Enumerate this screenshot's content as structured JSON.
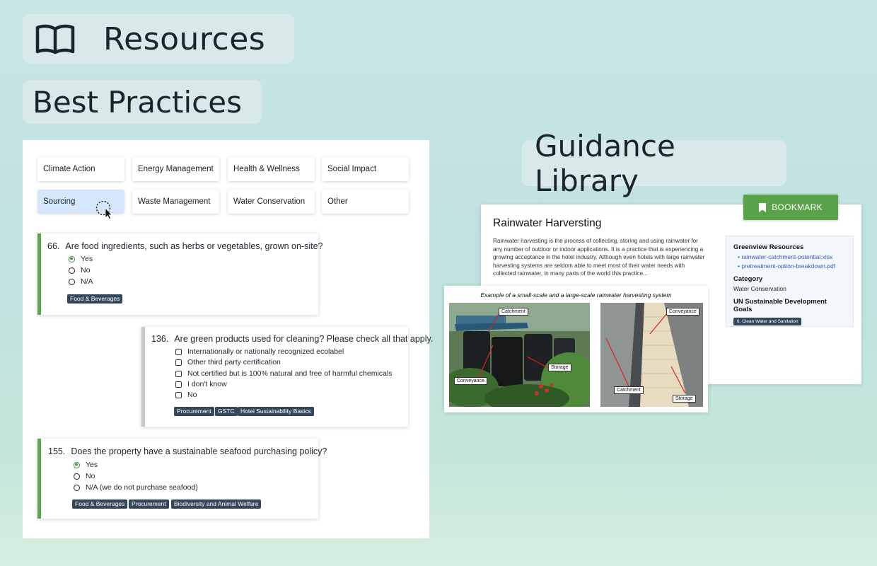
{
  "headers": {
    "resources": "Resources",
    "best_practices": "Best Practices",
    "guidance_library": "Guidance Library"
  },
  "categories": [
    {
      "label": "Climate Action",
      "active": false
    },
    {
      "label": "Energy Management",
      "active": false
    },
    {
      "label": "Health & Wellness",
      "active": false
    },
    {
      "label": "Social Impact",
      "active": false
    },
    {
      "label": "Sourcing",
      "active": true
    },
    {
      "label": "Waste Management",
      "active": false
    },
    {
      "label": "Water Conservation",
      "active": false
    },
    {
      "label": "Other",
      "active": false
    }
  ],
  "questions": [
    {
      "number": "66.",
      "text": "Are food ingredients, such as herbs or vegetables, grown on-site?",
      "options": [
        "Yes",
        "No",
        "N/A"
      ],
      "selected": "Yes",
      "tags": [
        "Food & Beverages"
      ]
    },
    {
      "number": "136.",
      "text": "Are green products used for cleaning? Please check all that apply.",
      "options": [
        "Internationally or nationally recognized ecolabel",
        "Other third party certification",
        "Not certified but is 100% natural and free of harmful chemicals",
        "I don't know",
        "No"
      ],
      "tags": [
        "Procurement",
        "GSTC",
        "Hotel Sustainability Basics"
      ]
    },
    {
      "number": "155.",
      "text": "Does the property have a sustainable seafood purchasing policy?",
      "options": [
        "Yes",
        "No",
        "N/A (we do not purchase seafood)"
      ],
      "selected": "Yes",
      "tags": [
        "Food & Beverages",
        "Procurement",
        "Biodiversity and Animal Welfare"
      ]
    }
  ],
  "guidance": {
    "bookmark_label": "BOOKMARK",
    "title": "Rainwater Harversting",
    "body": "Rainwater harvesting is the process of collecting, storing and using rainwater for any number of outdoor or indoor applications. It is a practice that is experiencing a growing acceptance in the hotel industry. Although even hotels with large rainwater harvesting systems are seldom able to meet most of their water needs with collected rainwater, in many parts of the world this practice...",
    "resources_heading": "Greenview Resources",
    "resources": [
      "rainwater-catchment-potential.xlsx",
      "pretreatment-option-breakdown.pdf"
    ],
    "category_heading": "Category",
    "category_value": "Water Conservation",
    "sdg_heading": "UN Sustainable Development Goals",
    "sdg_tag": "6. Clean Water and Sanitation",
    "figure_caption": "Example of a small-scale and a large-scale rainwater harvesting system",
    "photo_left_labels": [
      "Catchment",
      "Storage",
      "Conveyance"
    ],
    "photo_right_labels": [
      "Conveyance",
      "Catchment",
      "Storage"
    ]
  },
  "colors": {
    "accent_green": "#5aa34a",
    "tag_bg": "#33475b",
    "link_blue": "#2f62c4",
    "active_tab": "#d6e7fb"
  }
}
